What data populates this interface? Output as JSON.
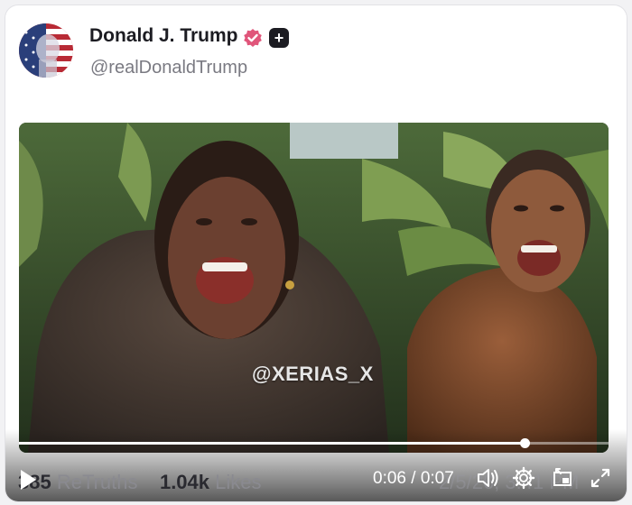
{
  "post": {
    "author_name": "Donald J. Trump",
    "handle": "@realDonaldTrump",
    "avatar_icon": "american-flag-portrait-avatar",
    "verified_icon": "verified-badge-icon",
    "verified_color": "#e0557a",
    "plus_badge": "+"
  },
  "video": {
    "watermark": "@XERIAS_X",
    "time_display": "0:06 / 0:07",
    "progress": 0.8571,
    "controls": [
      "play-icon",
      "volume-icon",
      "settings-icon",
      "picture-in-picture-icon",
      "fullscreen-icon"
    ]
  },
  "stats": {
    "retruths_count": "385",
    "retruths_label": "ReTruths",
    "likes_count": "1.04k",
    "likes_label": "Likes",
    "timestamp": "2/5/26, 3:41 PM"
  }
}
